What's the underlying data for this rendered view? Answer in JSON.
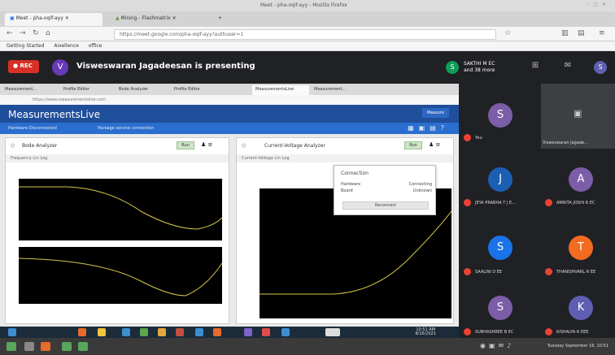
{
  "browser": {
    "window_title": "Meet - pha-oqif-ayy - Mozilla Firefox",
    "tabs": [
      {
        "label": "Meet - pha-oqif-ayy",
        "active": true
      },
      {
        "label": "Mining - Flashmatrix",
        "active": false
      }
    ],
    "url": "https://meet.google.com/pha-oqif-ayy?authuser=1",
    "bookmarks": [
      "Getting Started",
      "Aixellence",
      "office"
    ]
  },
  "meet": {
    "rec_label": "REC",
    "presenter_initial": "V",
    "presenting_text": "Visweswaran Jagadeesan is presenting",
    "me": {
      "initial": "S",
      "name": "SAKTHI M EC",
      "sub": "and 38 more"
    },
    "self_caption": "Visweswaran Jagade...",
    "participants": [
      {
        "initial": "S",
        "name": "You",
        "color": "#7b5ea7"
      },
      {
        "initial": "J",
        "name": "JEYA PRABHA T J E...",
        "color": "#1a5fb4"
      },
      {
        "initial": "A",
        "name": "AMRITA JOSHI R EC",
        "color": "#7b5ea7"
      },
      {
        "initial": "S",
        "name": "SAALINI D EE",
        "color": "#1a73e8"
      },
      {
        "initial": "T",
        "name": "THANISHVARL R EE",
        "color": "#f26b21"
      },
      {
        "initial": "S",
        "name": "SUBHASHREE B EC",
        "color": "#7b5ea7"
      },
      {
        "initial": "K",
        "name": "KISHALYA R EEE",
        "color": "#5e5eb2"
      }
    ]
  },
  "shared": {
    "inner_tabs": [
      "Measurement...",
      "Profile Editor",
      "Bode Analyzer",
      "Profile Editor",
      "MeasurementsLive",
      "Measurement..."
    ],
    "inner_url": "https://www.measurementslive.com",
    "app_logo": "MeasurementsLive",
    "header_button": "Measure",
    "sub_left": "Hardware Disconnected",
    "sub_mid": "Package service connection",
    "panel_left_title": "Bode Analyzer",
    "panel_right_title": "Current-Voltage Analyzer",
    "run_label": "Run",
    "left_toolbar": "Frequency   Lin   Log",
    "right_toolbar": "Current-Voltage   Lin   Log",
    "popup": {
      "title": "Connection",
      "row1_label": "Hardware",
      "row1_value": "Connecting",
      "row2_label": "Board",
      "row2_value": "Unknown",
      "button": "Reconnect"
    },
    "win_clock": {
      "time": "10:51 AM",
      "date": "8/16/2021"
    }
  },
  "os": {
    "clock": "Tuesday September 16, 10:51"
  }
}
